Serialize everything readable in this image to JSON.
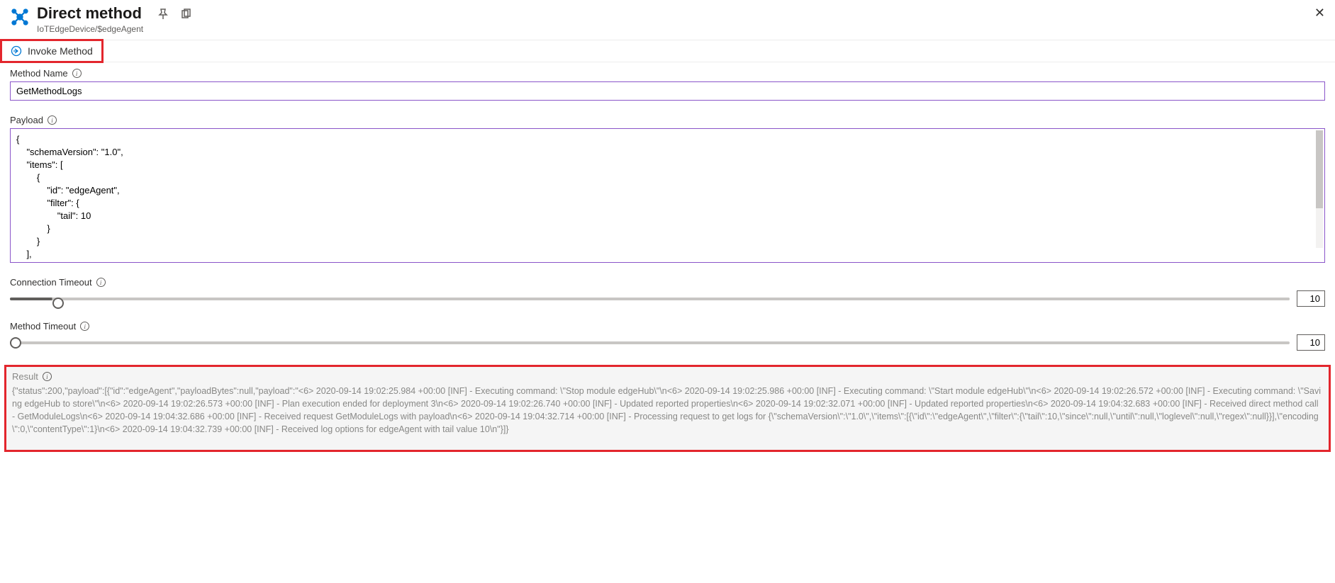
{
  "header": {
    "title": "Direct method",
    "breadcrumb": "IoTEdgeDevice/$edgeAgent"
  },
  "toolbar": {
    "invoke_label": "Invoke Method"
  },
  "fields": {
    "method_name_label": "Method Name",
    "method_name_value": "GetMethodLogs",
    "payload_label": "Payload",
    "payload_value": "{\n    \"schemaVersion\": \"1.0\",\n    \"items\": [\n        {\n            \"id\": \"edgeAgent\",\n            \"filter\": {\n                \"tail\": 10\n            }\n        }\n    ],",
    "connection_timeout_label": "Connection Timeout",
    "connection_timeout_value": "10",
    "method_timeout_label": "Method Timeout",
    "method_timeout_value": "10",
    "result_label": "Result",
    "result_value": "{\"status\":200,\"payload\":[{\"id\":\"edgeAgent\",\"payloadBytes\":null,\"payload\":\"<6> 2020-09-14 19:02:25.984 +00:00 [INF] - Executing command: \\\"Stop module edgeHub\\\"\\n<6> 2020-09-14 19:02:25.986 +00:00 [INF] - Executing command: \\\"Start module edgeHub\\\"\\n<6> 2020-09-14 19:02:26.572 +00:00 [INF] - Executing command: \\\"Saving edgeHub to store\\\"\\n<6> 2020-09-14 19:02:26.573 +00:00 [INF] - Plan execution ended for deployment 3\\n<6> 2020-09-14 19:02:26.740 +00:00 [INF] - Updated reported properties\\n<6> 2020-09-14 19:02:32.071 +00:00 [INF] - Updated reported properties\\n<6> 2020-09-14 19:04:32.683 +00:00 [INF] - Received direct method call - GetModuleLogs\\n<6> 2020-09-14 19:04:32.686 +00:00 [INF] - Received request GetModuleLogs with payload\\n<6> 2020-09-14 19:04:32.714 +00:00 [INF] - Processing request to get logs for {\\\"schemaVersion\\\":\\\"1.0\\\",\\\"items\\\":[{\\\"id\\\":\\\"edgeAgent\\\",\\\"filter\\\":{\\\"tail\\\":10,\\\"since\\\":null,\\\"until\\\":null,\\\"loglevel\\\":null,\\\"regex\\\":null}}],\\\"encoding\\\":0,\\\"contentType\\\":1}\\n<6> 2020-09-14 19:04:32.739 +00:00 [INF] - Received log options for edgeAgent with tail value 10\\n\"}]}"
  }
}
